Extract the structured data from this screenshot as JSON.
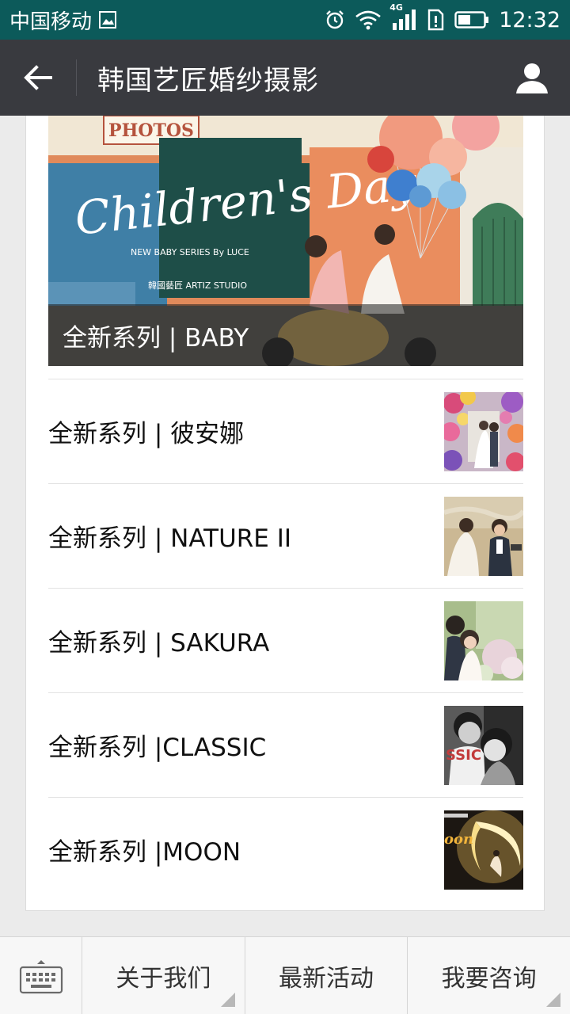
{
  "status_bar": {
    "carrier": "中国移动",
    "network": "4G",
    "time": "12:32"
  },
  "header": {
    "title": "韩国艺匠婚纱摄影"
  },
  "hero": {
    "caption": "全新系列 | BABY",
    "poster_text": "Children's Day",
    "poster_sub": "NEW BABY SERIES By LUCE",
    "sign_text": "PHOTOS",
    "studio_text": "韓國藝匠 ARTIZ STUDIO"
  },
  "articles": [
    {
      "title": "全新系列 | 彼安娜"
    },
    {
      "title": "全新系列 | NATURE II"
    },
    {
      "title": "全新系列 | SAKURA"
    },
    {
      "title": "全新系列 |CLASSIC"
    },
    {
      "title": "全新系列 |MOON"
    }
  ],
  "bottom_menu": {
    "items": [
      {
        "label": "关于我们"
      },
      {
        "label": "最新活动"
      },
      {
        "label": "我要咨询"
      }
    ]
  },
  "colors": {
    "status_bar": "#0c5a5a",
    "app_bar": "#393a3f",
    "background": "#ebebeb"
  }
}
